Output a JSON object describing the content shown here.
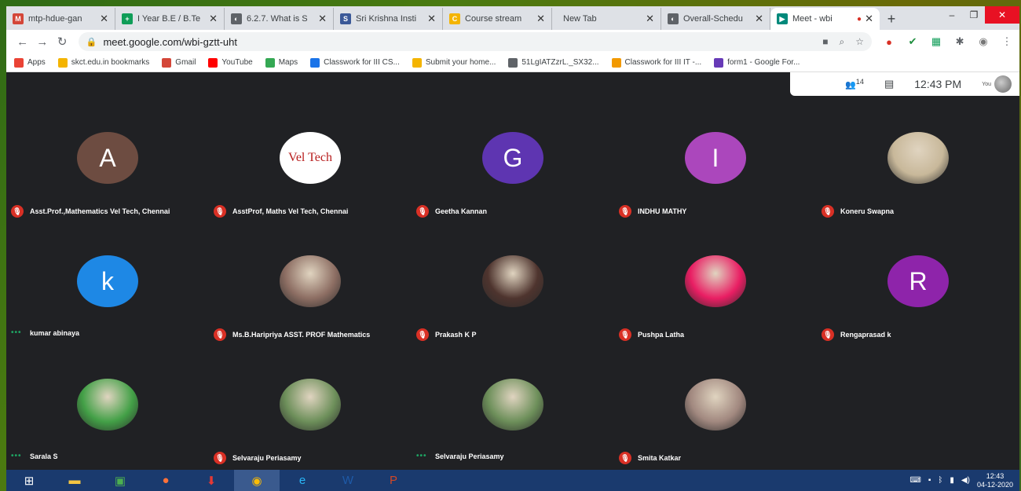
{
  "browser": {
    "tabs": [
      {
        "title": "mtp-hdue-gan",
        "favicon_color": "#d44638",
        "favicon": "M"
      },
      {
        "title": "I Year B.E / B.Te",
        "favicon_color": "#0f9d58",
        "favicon": "+"
      },
      {
        "title": "6.2.7. What is S",
        "favicon_color": "#5f6368",
        "favicon": "◐"
      },
      {
        "title": "Sri Krishna Insti",
        "favicon_color": "#3b5998",
        "favicon": "S"
      },
      {
        "title": "Course stream",
        "favicon_color": "#f4b400",
        "favicon": "C"
      },
      {
        "title": "New Tab",
        "favicon_color": "",
        "favicon": ""
      },
      {
        "title": "Overall-Schedu",
        "favicon_color": "#5f6368",
        "favicon": "◐"
      },
      {
        "title": "Meet - wbi",
        "favicon_color": "#00897b",
        "favicon": "▶",
        "active": true
      }
    ],
    "url": "meet.google.com/wbi-gztt-uht",
    "new_tab": "+",
    "win_min": "–",
    "win_max": "❐",
    "win_close": "✕"
  },
  "bookmarks": [
    {
      "label": "Apps",
      "color": "#ea4335"
    },
    {
      "label": "skct.edu.in bookmarks",
      "color": "#f4b400"
    },
    {
      "label": "Gmail",
      "color": "#d44638"
    },
    {
      "label": "YouTube",
      "color": "#ff0000"
    },
    {
      "label": "Maps",
      "color": "#34a853"
    },
    {
      "label": "Classwork for III CS...",
      "color": "#1a73e8"
    },
    {
      "label": "Submit your home...",
      "color": "#f4b400"
    },
    {
      "label": "51LgIATZzrL._SX32...",
      "color": "#5f6368"
    },
    {
      "label": "Classwork for III IT -...",
      "color": "#f29900"
    },
    {
      "label": "form1 - Google For...",
      "color": "#673ab7"
    }
  ],
  "meet": {
    "participants_count": "14",
    "time": "12:43 PM",
    "you_label": "You",
    "participants": [
      {
        "name": "Asst.Prof.,Mathematics Vel Tech, Chennai",
        "initial": "A",
        "bg": "#6d4c41",
        "muted": true
      },
      {
        "name": "AsstProf, Maths Vel Tech, Chennai",
        "initial": "Vel Tech",
        "bg": "#ffffff",
        "muted": true,
        "logo": true
      },
      {
        "name": "Geetha Kannan",
        "initial": "G",
        "bg": "#5e35b1",
        "muted": true
      },
      {
        "name": "INDHU MATHY",
        "initial": "I",
        "bg": "#ab47bc",
        "muted": true
      },
      {
        "name": "Koneru Swapna",
        "initial": "",
        "bg": "#c8b89a",
        "muted": true
      },
      {
        "name": "kumar abinaya",
        "initial": "k",
        "bg": "#1e88e5",
        "muted": false
      },
      {
        "name": "Ms.B.Haripriya ASST. PROF Mathematics",
        "initial": "",
        "bg": "#8d6e63",
        "muted": true
      },
      {
        "name": "Prakash K P",
        "initial": "",
        "bg": "#4e342e",
        "muted": true
      },
      {
        "name": "Pushpa Latha",
        "initial": "",
        "bg": "#e91e63",
        "muted": true
      },
      {
        "name": "Rengaprasad k",
        "initial": "R",
        "bg": "#8e24aa",
        "muted": true
      },
      {
        "name": "Sarala S",
        "initial": "",
        "bg": "#43a047",
        "muted": false
      },
      {
        "name": "Selvaraju Periasamy",
        "initial": "",
        "bg": "#6d8f5a",
        "muted": true
      },
      {
        "name": "Selvaraju Periasamy",
        "initial": "",
        "bg": "#6d8f5a",
        "muted": false
      },
      {
        "name": "Smita Katkar",
        "initial": "",
        "bg": "#a1887f",
        "muted": true
      }
    ]
  },
  "taskbar": {
    "clock_time": "12:43",
    "clock_date": "04-12-2020"
  }
}
